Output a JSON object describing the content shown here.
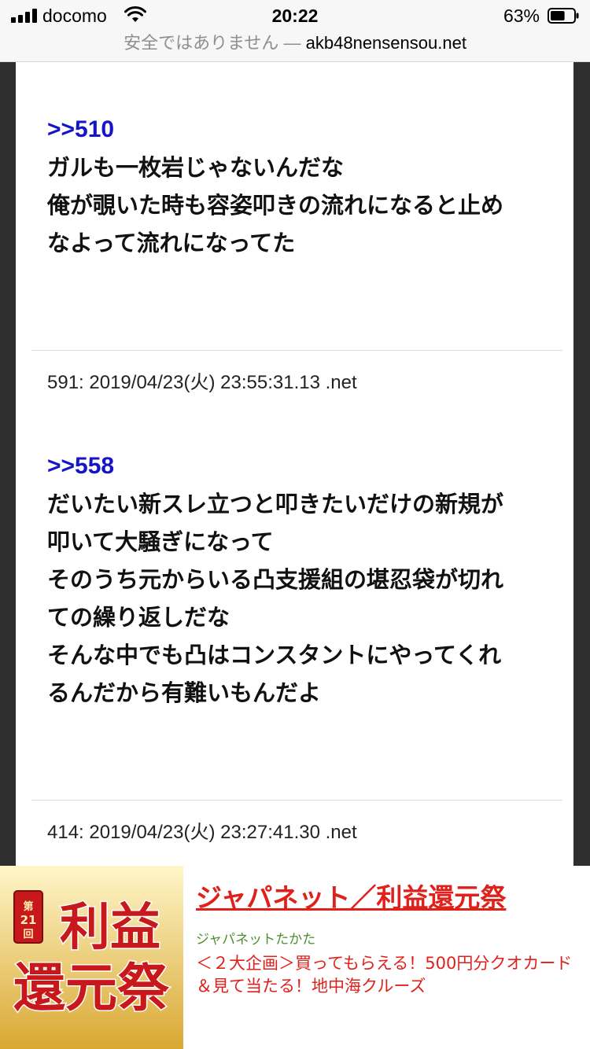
{
  "status_bar": {
    "carrier": "docomo",
    "time": "20:22",
    "battery_percent": "63%",
    "battery_level": 0.63
  },
  "url_bar": {
    "security_label": "安全ではありません",
    "separator": " — ",
    "domain": "akb48nensensou.net"
  },
  "posts": [
    {
      "anchor": ">>510",
      "lines": [
        "ガルも一枚岩じゃないんだな",
        "俺が覗いた時も容姿叩きの流れになると止め",
        "なよって流れになってた"
      ]
    },
    {
      "meta": "591: 2019/04/23(火) 23:55:31.13 .net",
      "anchor": ">>558",
      "lines": [
        "だいたい新スレ立つと叩きたいだけの新規が",
        "叩いて大騒ぎになって",
        "そのうち元からいる凸支援組の堪忍袋が切れ",
        "ての繰り返しだな",
        "そんな中でも凸はコンスタントにやってくれ",
        "るんだから有難いもんだよ"
      ]
    },
    {
      "meta": "414: 2019/04/23(火) 23:27:41.30 .net"
    }
  ],
  "ad": {
    "image_text": {
      "badge": "第21回",
      "line1": "利益",
      "line2": "還元祭"
    },
    "title": "ジャパネット／利益還元祭",
    "advertiser": "ジャパネットたかた",
    "description": "＜２大企画＞買ってもらえる！500円分クオカード＆見て当たる！地中海クルーズ"
  },
  "colors": {
    "anchor": "#1414c8",
    "ad_title": "#e0201b",
    "ad_advertiser": "#4a8f2a",
    "frame": "#2f2f2f"
  }
}
